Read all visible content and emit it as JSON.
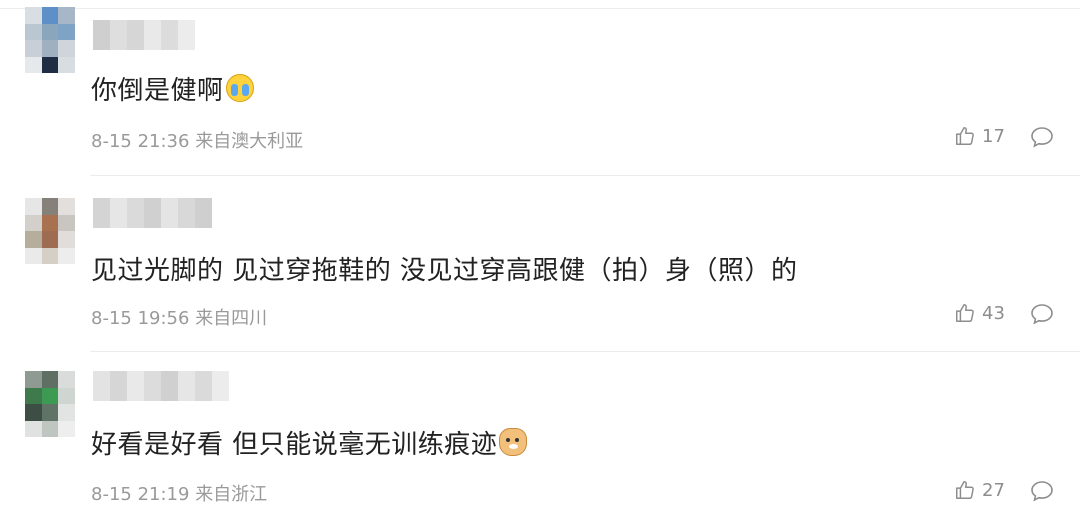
{
  "comments": [
    {
      "text": "你倒是健啊",
      "emoji": "crying-face-icon",
      "date": "8-15 21:36",
      "location": "来自澳大利亚",
      "likes": "17",
      "avatar_colors": [
        "#d9dee3",
        "#5f8fc7",
        "#a8b7c8",
        "#bac6d0",
        "#8aa6bd",
        "#7ea3c4",
        "#c9cfd6",
        "#9fb0c0",
        "#cfd5db",
        "#e6e9ec",
        "#1f2d44",
        "#d8dde2"
      ],
      "username_colors": [
        "#cfcfcf",
        "#dedede",
        "#d6d6d6",
        "#e9e9e9",
        "#dcdcdc",
        "#ececec"
      ]
    },
    {
      "text": "见过光脚的 见过穿拖鞋的 没见过穿高跟健（拍）身（照）的",
      "emoji": "",
      "date": "8-15 19:56",
      "location": "来自四川",
      "likes": "43",
      "avatar_colors": [
        "#e6e6e6",
        "#858079",
        "#e2dfdc",
        "#d3d0cc",
        "#a8714f",
        "#c9c6c2",
        "#b6ae9d",
        "#9d6c53",
        "#e0ddda",
        "#eaeaea",
        "#d5cfc6",
        "#ededed"
      ],
      "username_colors": [
        "#d4d4d4",
        "#e6e6e6",
        "#dadada",
        "#d0d0d0",
        "#e4e4e4",
        "#d8d8d8",
        "#cfcfcf"
      ]
    },
    {
      "text": "好看是好看 但只能说毫无训练痕迹",
      "emoji": "doge-icon",
      "date": "8-15 21:19",
      "location": "来自浙江",
      "likes": "27",
      "avatar_colors": [
        "#8f9a92",
        "#5f6f64",
        "#d9dcda",
        "#3f7a4c",
        "#3d9a53",
        "#cfd6d1",
        "#3d4f44",
        "#5f7467",
        "#e2e4e3",
        "#dfe2e0",
        "#bfc6c1",
        "#eeeeee"
      ],
      "username_colors": [
        "#e3e3e3",
        "#d6d6d6",
        "#e9e9e9",
        "#dcdcdc",
        "#d0d0d0",
        "#e6e6e6",
        "#dadada",
        "#ececec"
      ]
    }
  ]
}
